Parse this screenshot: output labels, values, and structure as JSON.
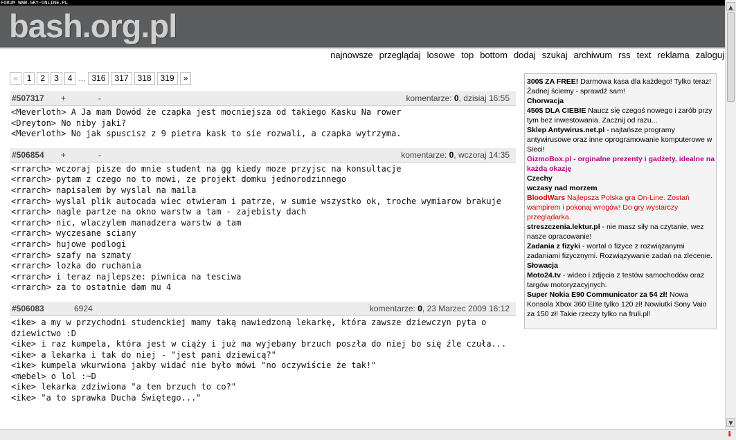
{
  "topbar": {
    "text": "FORUM WWW.GRY-ONLINE.PL"
  },
  "site": {
    "logo": "bash.org.pl"
  },
  "nav": [
    "najnowsze",
    "przeglądaj",
    "losowe",
    "top",
    "bottom",
    "dodaj",
    "szukaj",
    "archiwum",
    "rss",
    "text",
    "reklama",
    "zaloguj"
  ],
  "pager": {
    "prev": "«",
    "first_pages": [
      "1",
      "2",
      "3",
      "4"
    ],
    "ellipsis": "...",
    "last_pages": [
      "316",
      "317",
      "318",
      "319"
    ],
    "next": "»"
  },
  "quotes": [
    {
      "id": "#507317",
      "plus": "+",
      "score": "",
      "minus": "-",
      "comments_label": "komentarze:",
      "comments": "0",
      "date": ", dzisiaj 16:55",
      "lines": [
        "<Meverloth> A Ja mam Dowód że czapka jest mocniejsza od takiego Kasku Na rower",
        "<Dreyton> No niby jaki?",
        "<Meverloth> No jak spuscisz z 9 pietra kask to sie rozwali, a czapka wytrzyma."
      ]
    },
    {
      "id": "#506854",
      "plus": "+",
      "score": "",
      "minus": "-",
      "comments_label": "komentarze:",
      "comments": "0",
      "date": ", wczoraj 14:35",
      "lines": [
        "<rrarch> wczoraj pisze do mnie student na gg kiedy moze przyjsc na konsultacje",
        "<rrarch> pytam z czego no to mowi, ze projekt domku jednorodzinnego",
        "<rrarch> napisalem by wyslal na maila",
        "<rrarch> wyslal plik autocada wiec otwieram i patrze, w sumie wszystko ok, troche wymiarow brakuje",
        "<rrarch> nagle partze na okno warstw a tam - zajebisty dach",
        "<rrarch> nic, wlaczylem manadzera warstw a tam",
        "<rrarch> wyczesane sciany",
        "<rrarch> hujowe podlogi",
        "<rrarch> szafy na szmaty",
        "<rrarch> lozka do ruchania",
        "<rrarch> i teraz najlepsze: piwnica na tesciwa",
        "<rrarch> za to ostatnie dam mu 4"
      ]
    },
    {
      "id": "#506083",
      "plus": "",
      "score": "6924",
      "minus": "",
      "comments_label": "komentarze:",
      "comments": "0",
      "date": ", 23 Marzec 2009 16:12",
      "lines": [
        "<ike> a my w przychodni studenckiej mamy taką nawiedzoną lekarkę, która zawsze dziewczyn pyta o dziewictwo :D",
        "<ike> i raz kumpela, która jest w ciąży i już ma wyjebany brzuch poszła do niej bo się źle czuła...",
        "<ike> a lekarka i tak do niej - \"jest pani dziewicą?\"",
        "<ike> kumpela wkurwiona jakby widać nie było mówi \"no oczywiście że tak!\"",
        "<mebel> o lol :~D",
        "<ike> lekarka zdziwiona \"a ten brzuch to co?\"",
        "<ike> \"a to sprawka Ducha Świętego...\""
      ]
    }
  ],
  "ads": [
    {
      "title": "300$ ZA FREE!",
      "title_color": "black",
      "desc": " Darmowa kasa dla każdego! Tylko teraz! Żadnej ściemy - sprawdź sam!",
      "desc_color": "black"
    },
    {
      "title": "Chorwacja",
      "title_color": "black",
      "desc": "",
      "desc_color": "black"
    },
    {
      "title": "450$ DLA CIEBIE",
      "title_color": "black",
      "desc": " Naucz się czegoś nowego i zarób przy tym bez inwestowania. Zacznij od razu...",
      "desc_color": "black"
    },
    {
      "title": "Sklep Antywirus.net.pl",
      "title_color": "black",
      "desc": " - najtańsze programy antywirusowe oraz inne oprogramowanie komputerowe w Sieci!",
      "desc_color": "black"
    },
    {
      "title": "GizmoBox.pl - orginalne prezenty i gadżety, idealne na każdą okazję",
      "title_color": "pink",
      "desc": "",
      "desc_color": "black"
    },
    {
      "title": "Czechy",
      "title_color": "black",
      "desc": "",
      "desc_color": "black"
    },
    {
      "title": "wczasy nad morzem",
      "title_color": "black",
      "desc": "",
      "desc_color": "black"
    },
    {
      "title": "BloodWars",
      "title_color": "red",
      "desc": " Najlepsza Polska gra On-Line. Zostań wampirem i pokonaj wrogów! Do gry wystarczy przeglądarka.",
      "desc_color": "red"
    },
    {
      "title": "streszczenia.lektur.pl",
      "title_color": "black",
      "desc": " - nie masz siły na czytanie, wez nasze opracowanie!",
      "desc_color": "black"
    },
    {
      "title": "Zadania z fizyki",
      "title_color": "black",
      "desc": " - wortal o fizyce z rozwiązanymi zadaniami fizycznymi. Rozwiązywanie zadań na zlecenie.",
      "desc_color": "black"
    },
    {
      "title": "Słowacja",
      "title_color": "black",
      "desc": "",
      "desc_color": "black"
    },
    {
      "title": "Moto24.tv",
      "title_color": "black",
      "desc": " - wideo i zdjęcia z testów samochodów oraz targów motoryzacyjnych.",
      "desc_color": "black"
    },
    {
      "title": "Super Nokia E90 Communicator za 54 zł!",
      "title_color": "black",
      "desc": " Nowa Konsola Xbox 360 Elite tylko 120 zł! Nowiutki Sony Vaio za 150 zł! Takie rzeczy tylko na fruli.pl!",
      "desc_color": "black"
    }
  ],
  "colors": {
    "header_bg": "#5b5d5f",
    "logo": "#cfcfcf",
    "pink": "#c0008a",
    "red": "#e00000"
  },
  "icons": {
    "scroll_up": "scroll-up-arrow-icon",
    "scroll_down": "scroll-down-arrow-icon",
    "status": "download-arrow-icon"
  }
}
